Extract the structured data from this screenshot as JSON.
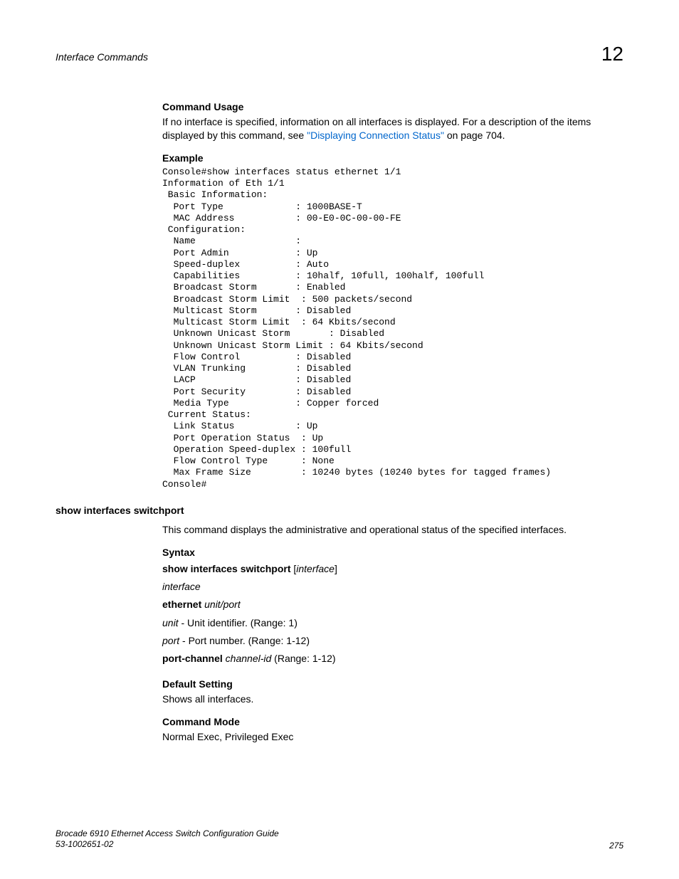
{
  "header": {
    "title": "Interface Commands",
    "chapter": "12"
  },
  "sec1": {
    "heading": "Command Usage",
    "text_before_link": "If no interface is specified, information on all interfaces is displayed. For a description of the items displayed by this command, see ",
    "link": "\"Displaying Connection Status\"",
    "text_after_link": " on page 704."
  },
  "example": {
    "heading": "Example",
    "code": "Console#show interfaces status ethernet 1/1\nInformation of Eth 1/1\n Basic Information:\n  Port Type             : 1000BASE-T\n  MAC Address           : 00-E0-0C-00-00-FE\n Configuration:\n  Name                  :\n  Port Admin            : Up\n  Speed-duplex          : Auto\n  Capabilities          : 10half, 10full, 100half, 100full\n  Broadcast Storm       : Enabled\n  Broadcast Storm Limit  : 500 packets/second\n  Multicast Storm       : Disabled\n  Multicast Storm Limit  : 64 Kbits/second\n  Unknown Unicast Storm       : Disabled\n  Unknown Unicast Storm Limit : 64 Kbits/second\n  Flow Control          : Disabled\n  VLAN Trunking         : Disabled\n  LACP                  : Disabled\n  Port Security         : Disabled\n  Media Type            : Copper forced\n Current Status:\n  Link Status           : Up\n  Port Operation Status  : Up\n  Operation Speed-duplex : 100full\n  Flow Control Type      : None\n  Max Frame Size         : 10240 bytes (10240 bytes for tagged frames)\nConsole#"
  },
  "cmd": {
    "name": "show interfaces switchport",
    "desc": "This command displays the administrative and operational status of the specified interfaces."
  },
  "syntax": {
    "heading": "Syntax",
    "line1_bold": "show interfaces switchport",
    "line1_italic": "interface",
    "interface": "interface",
    "ethernet": "ethernet",
    "unit_port": "unit/port",
    "unit_label": "unit",
    "unit_desc": " - Unit identifier. (Range: 1)",
    "port_label": "port",
    "port_desc": " - Port number. (Range: 1-12)",
    "portchannel": "port-channel",
    "channelid": "channel-id",
    "channel_range": " (Range: 1-12)"
  },
  "default_setting": {
    "heading": "Default Setting",
    "text": "Shows all interfaces."
  },
  "command_mode": {
    "heading": "Command Mode",
    "text": "Normal Exec, Privileged Exec"
  },
  "footer": {
    "guide": "Brocade 6910 Ethernet Access Switch Configuration Guide",
    "docnum": "53-1002651-02",
    "page": "275"
  }
}
